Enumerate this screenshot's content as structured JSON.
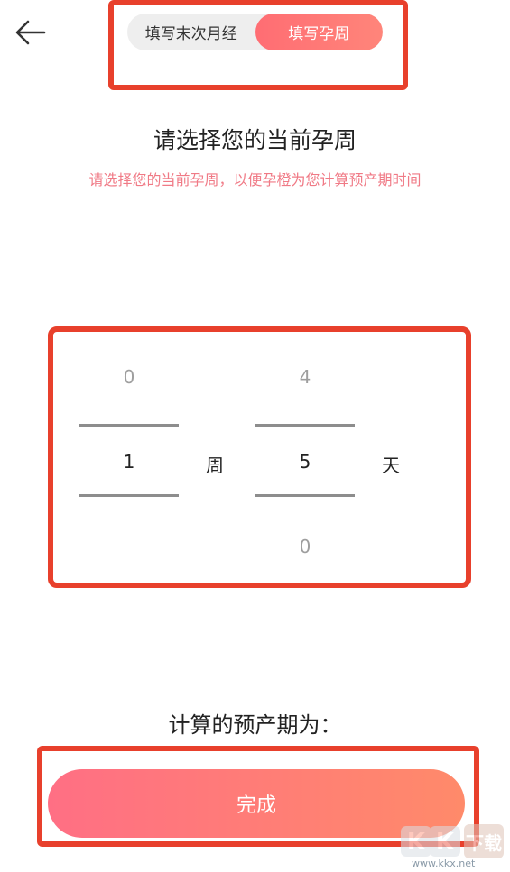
{
  "header": {
    "back_icon": "arrow-left-icon",
    "mode_tabs": [
      {
        "label": "填写末次月经",
        "active": false
      },
      {
        "label": "填写孕周",
        "active": true
      }
    ]
  },
  "main": {
    "title": "请选择您的当前孕周",
    "subtitle": "请选择您的当前孕周，以便孕橙为您计算预产期时间"
  },
  "picker": {
    "weeks": {
      "above": "0",
      "selected": "1",
      "below": ""
    },
    "week_unit": "周",
    "days": {
      "above": "4",
      "selected": "5",
      "below": "0"
    },
    "day_unit": "天"
  },
  "result": {
    "label": "计算的预产期为："
  },
  "footer": {
    "done_label": "完成"
  },
  "watermark": {
    "logo_text": "KK下载",
    "site": "www.kkx.net"
  },
  "colors": {
    "accent": "#ff6d73",
    "annotation_red": "#e8402c",
    "subtitle_pink": "#f07a86"
  }
}
